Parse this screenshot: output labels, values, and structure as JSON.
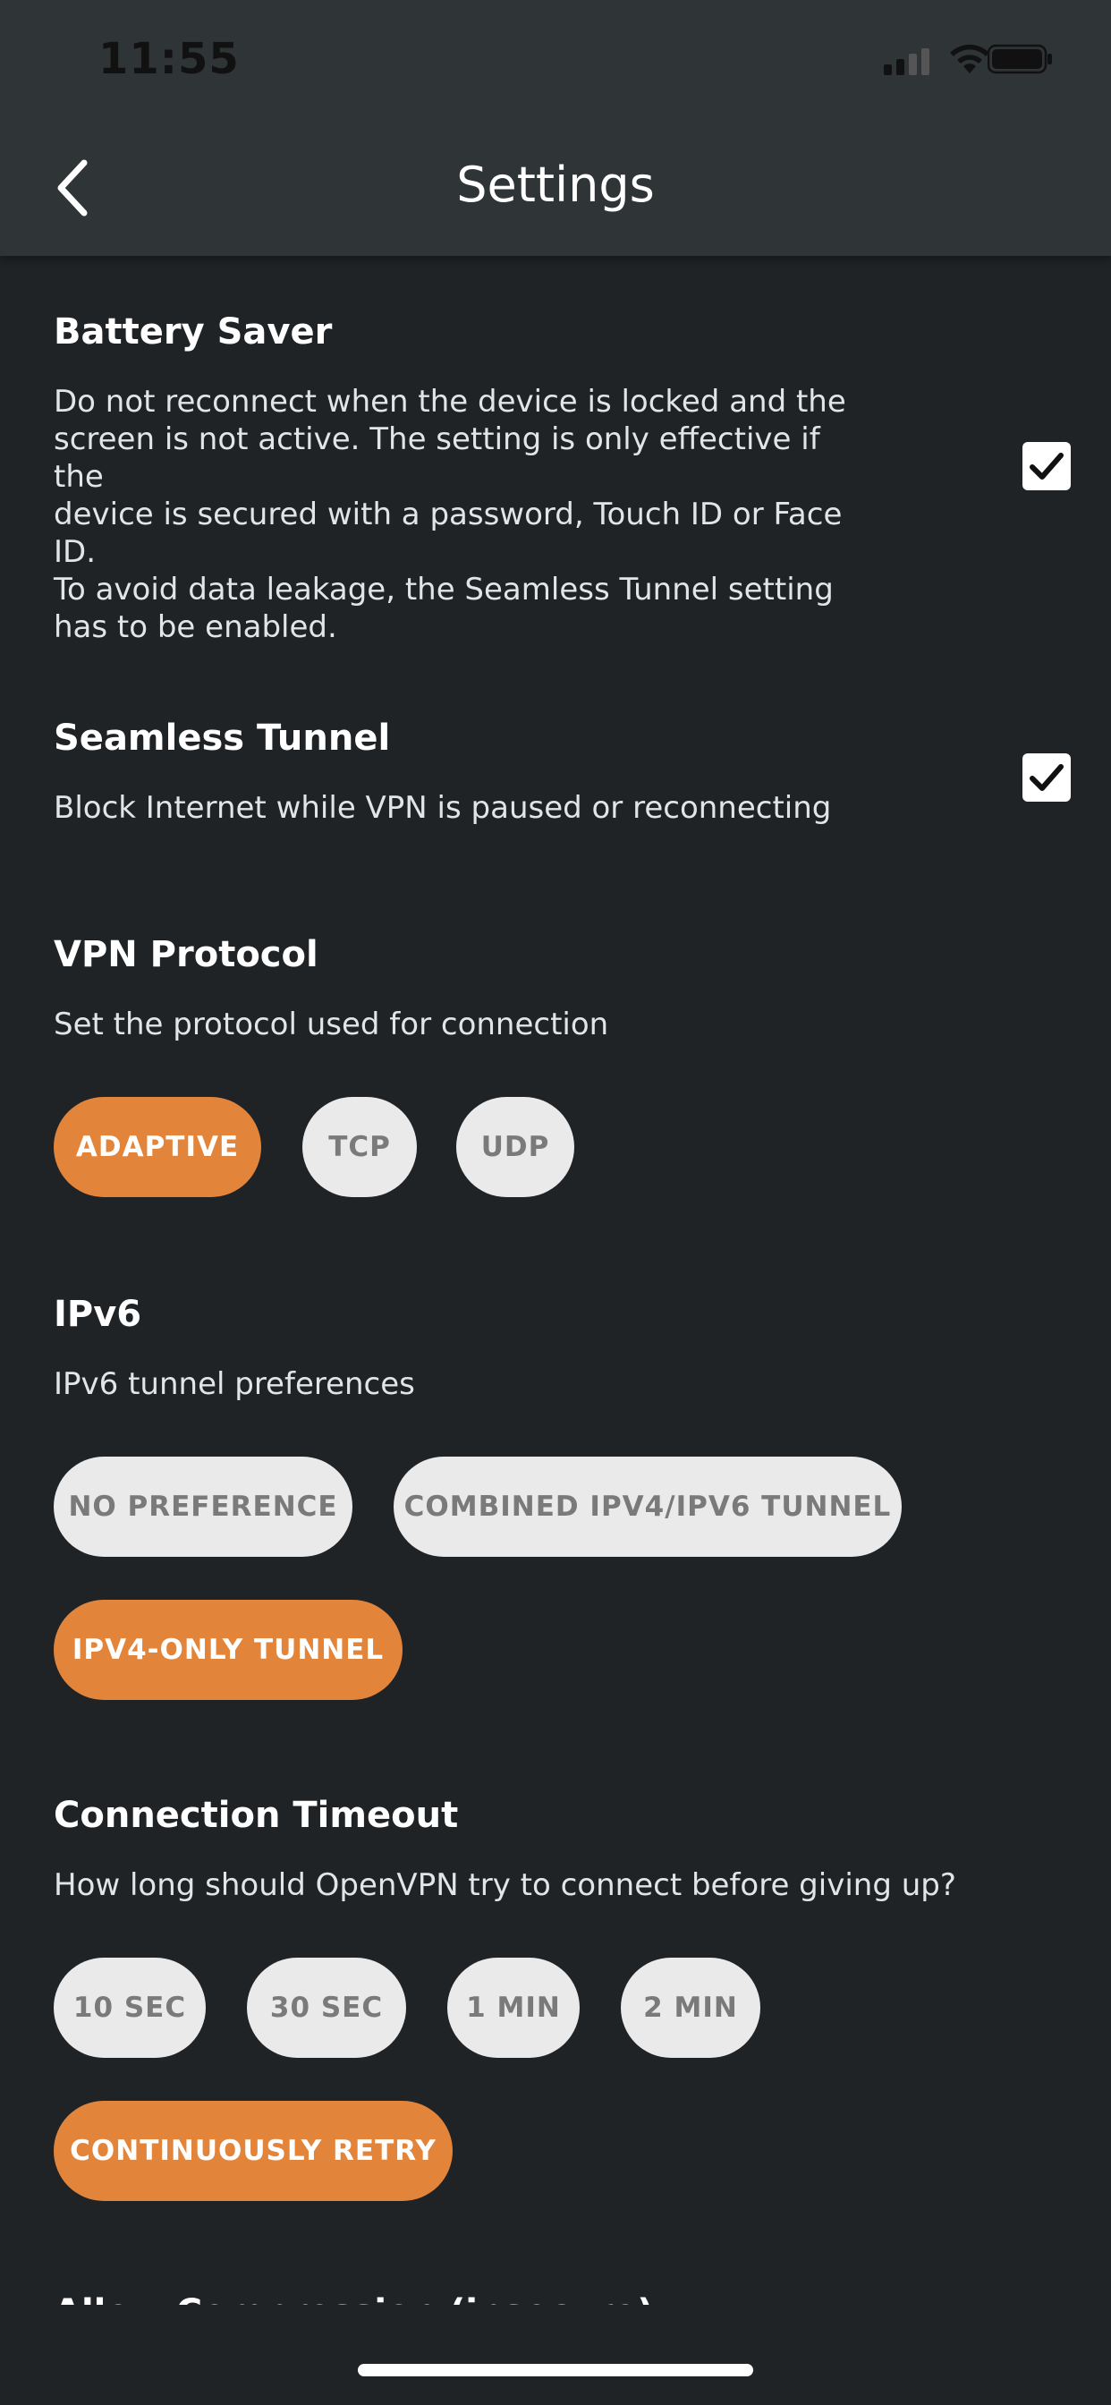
{
  "status_bar": {
    "time": "11:55"
  },
  "header": {
    "title": "Settings"
  },
  "battery_saver": {
    "title": "Battery Saver",
    "description_lines": [
      "Do not reconnect when the device is locked and the",
      "screen is not active. The setting is only effective if the",
      "device is secured with a password, Touch ID or Face",
      "ID.",
      "To avoid data leakage, the Seamless Tunnel setting",
      "has to be enabled."
    ],
    "checked": true
  },
  "seamless_tunnel": {
    "title": "Seamless Tunnel",
    "description": "Block Internet while VPN is paused or reconnecting",
    "checked": true
  },
  "vpn_protocol": {
    "title": "VPN Protocol",
    "description": "Set the protocol used for connection",
    "options": [
      "ADAPTIVE",
      "TCP",
      "UDP"
    ],
    "selected": "ADAPTIVE"
  },
  "ipv6": {
    "title": "IPv6",
    "description": "IPv6 tunnel preferences",
    "options": [
      "NO PREFERENCE",
      "COMBINED IPV4/IPV6 TUNNEL",
      "IPV4-ONLY TUNNEL"
    ],
    "selected": "IPV4-ONLY TUNNEL"
  },
  "connection_timeout": {
    "title": "Connection Timeout",
    "description": "How long should OpenVPN try to connect before giving up?",
    "options": [
      "10 SEC",
      "30 SEC",
      "1 MIN",
      "2 MIN",
      "CONTINUOUSLY RETRY"
    ],
    "selected": "CONTINUOUSLY RETRY"
  },
  "next_section_title": "Allow Compression (insecure)",
  "colors": {
    "accent": "#e3843b",
    "background": "#1f2326",
    "header": "#2f3437",
    "pill": "#eaeaea"
  }
}
